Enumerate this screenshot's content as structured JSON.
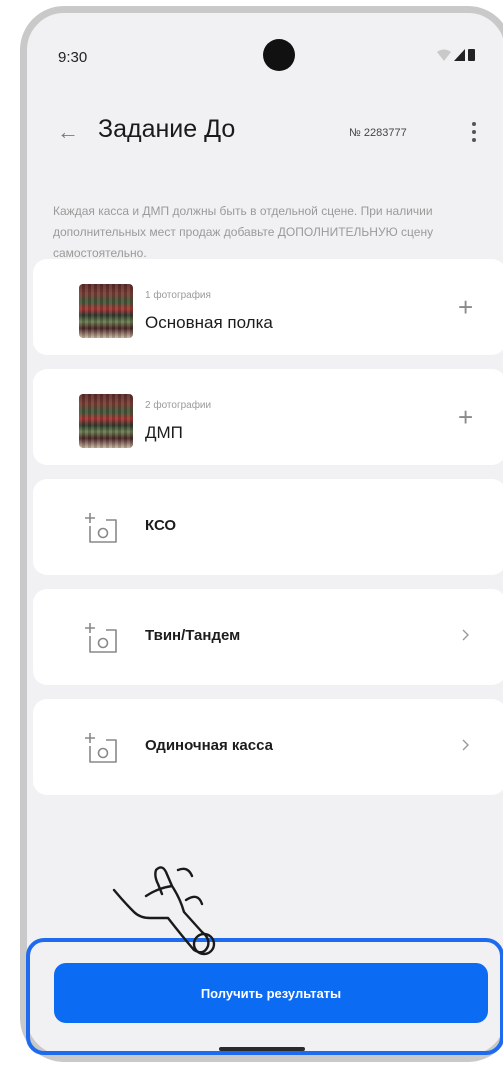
{
  "status_bar": {
    "time": "9:30"
  },
  "app_bar": {
    "title": "Задание До",
    "task_number": "№ 2283777"
  },
  "instructions": "Каждая касса и ДМП должны быть в отдельной сцене. При наличии дополнительных мест продаж добавьте ДОПОЛНИТЕЛЬНУЮ сцену самостоятельно.",
  "scenes": [
    {
      "photo_count": "1 фотография",
      "name": "Основная полка",
      "action": "plus-icon"
    },
    {
      "photo_count": "2 фотографии",
      "name": "ДМП",
      "action": "plus-icon"
    },
    {
      "name": "КСО",
      "action": "none"
    },
    {
      "name": "Твин/Тандем",
      "action": "chevron-right-icon"
    },
    {
      "name": "Одиночная касса",
      "action": "chevron-right-icon"
    }
  ],
  "footer": {
    "button_label": "Получить результаты"
  },
  "colors": {
    "accent": "#0b6bf2",
    "highlight_border": "#1f6bef",
    "background": "#f1f1f3"
  }
}
